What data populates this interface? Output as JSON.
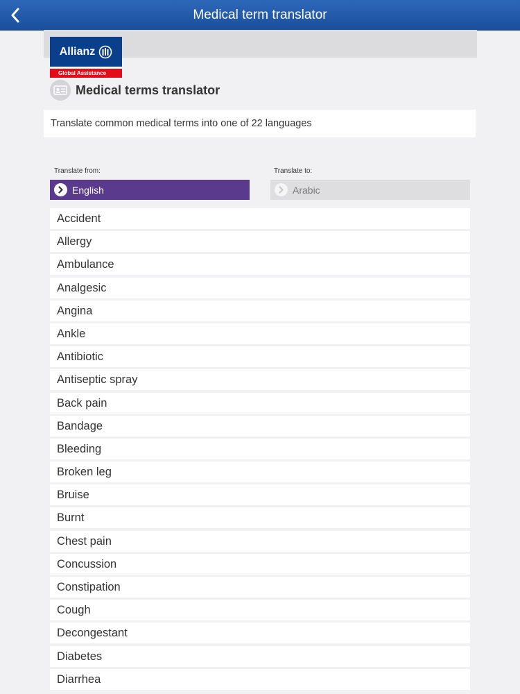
{
  "nav": {
    "title": "Medical term translator",
    "back_icon": "chevron-left-icon"
  },
  "logo": {
    "brand": "Allianz",
    "sub": "Global Assistance",
    "colors": {
      "blue": "#0a3f8c",
      "red": "#e30b17"
    }
  },
  "page": {
    "title": "Medical terms translator",
    "title_icon": "id-card-icon",
    "description": "Translate common medical terms into one of 22 languages"
  },
  "translate": {
    "from_label": "Translate from:",
    "from_value": "English",
    "to_label": "Translate to:",
    "to_value": "Arabic",
    "from_color": "#5a3a8c"
  },
  "terms": [
    "Accident",
    "Allergy",
    "Ambulance",
    "Analgesic",
    "Angina",
    "Ankle",
    "Antibiotic",
    "Antiseptic spray",
    "Back pain",
    "Bandage",
    "Bleeding",
    "Broken leg",
    "Bruise",
    "Burnt",
    "Chest pain",
    "Concussion",
    "Constipation",
    "Cough",
    "Decongestant",
    "Diabetes",
    "Diarrhea"
  ]
}
